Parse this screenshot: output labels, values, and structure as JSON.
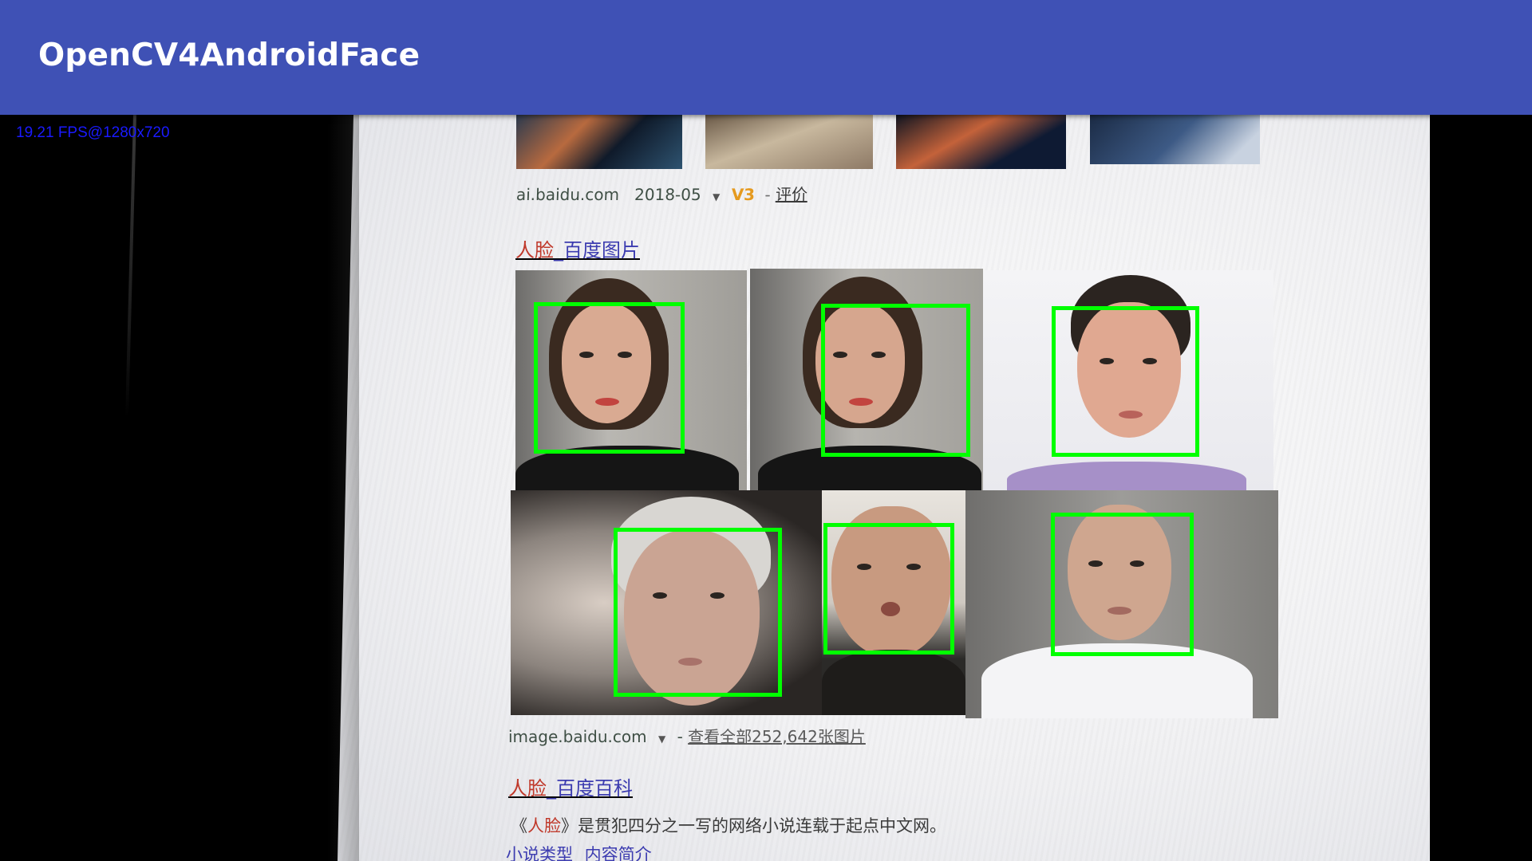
{
  "app_bar": {
    "title": "OpenCV4AndroidFace",
    "color": "#3F51B5"
  },
  "fps_overlay": {
    "text": "19.21 FPS@1280x720",
    "color": "#1a1aff"
  },
  "camera_scene": {
    "result_1_meta": {
      "domain": "ai.baidu.com",
      "date": "2018-05",
      "badge": "V3",
      "separator": "-",
      "review": "评价"
    },
    "result_2": {
      "title_highlight": "人脸",
      "title_rest": "_百度图片",
      "domain": "image.baidu.com",
      "separator": "-",
      "view_all": "查看全部252,642张图片"
    },
    "result_3": {
      "title_highlight": "人脸",
      "title_rest": "_百度百科",
      "snippet_prefix": "《",
      "snippet_highlight": "人脸",
      "snippet_rest": "》是贯犯四分之一写的网络小说连载于起点中文网。",
      "links": "小说类型 内容简介"
    }
  },
  "detections": {
    "count": 6,
    "box_color": "#00ff00"
  },
  "icons": [
    "dropdown-arrow-icon"
  ]
}
